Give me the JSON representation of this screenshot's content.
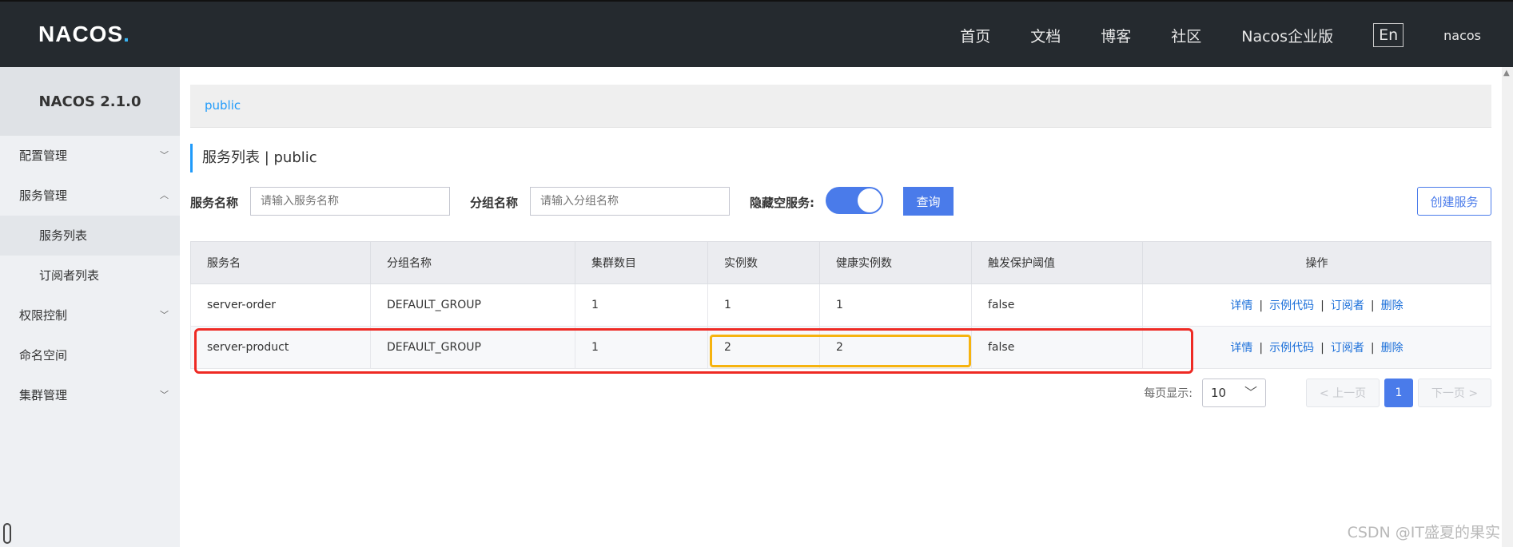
{
  "header": {
    "logo_text": "NACOS",
    "logo_dot": ".",
    "nav": [
      "首页",
      "文档",
      "博客",
      "社区",
      "Nacos企业版"
    ],
    "lang": "En",
    "user": "nacos"
  },
  "sidebar": {
    "version": "NACOS 2.1.0",
    "items": [
      {
        "label": "配置管理",
        "chevron": "﹀"
      },
      {
        "label": "服务管理",
        "chevron": "︿"
      },
      {
        "label": "服务列表"
      },
      {
        "label": "订阅者列表"
      },
      {
        "label": "权限控制",
        "chevron": "﹀"
      },
      {
        "label": "命名空间"
      },
      {
        "label": "集群管理",
        "chevron": "﹀"
      }
    ]
  },
  "namespace": "public",
  "page_title": "服务列表 | public",
  "search": {
    "service_label": "服务名称",
    "service_placeholder": "请输入服务名称",
    "group_label": "分组名称",
    "group_placeholder": "请输入分组名称",
    "hide_empty_label": "隐藏空服务:",
    "hide_empty_on": true,
    "query_label": "查询",
    "create_label": "创建服务"
  },
  "table": {
    "headers": [
      "服务名",
      "分组名称",
      "集群数目",
      "实例数",
      "健康实例数",
      "触发保护阈值",
      "操作"
    ],
    "rows": [
      {
        "name": "server-order",
        "group": "DEFAULT_GROUP",
        "clusters": "1",
        "instances": "1",
        "healthy": "1",
        "threshold": "false"
      },
      {
        "name": "server-product",
        "group": "DEFAULT_GROUP",
        "clusters": "1",
        "instances": "2",
        "healthy": "2",
        "threshold": "false"
      }
    ],
    "ops": [
      "详情",
      "示例代码",
      "订阅者",
      "删除"
    ],
    "op_sep": "|"
  },
  "pagination": {
    "page_size_label": "每页显示:",
    "page_size": "10",
    "prev": "< 上一页",
    "current": "1",
    "next": "下一页 >"
  },
  "watermark": "CSDN @IT盛夏的果实",
  "colors": {
    "accent": "#4a7bea",
    "link": "#1b6fd9",
    "highlight_red": "#ee2a24",
    "highlight_orange": "#f6b30f"
  }
}
